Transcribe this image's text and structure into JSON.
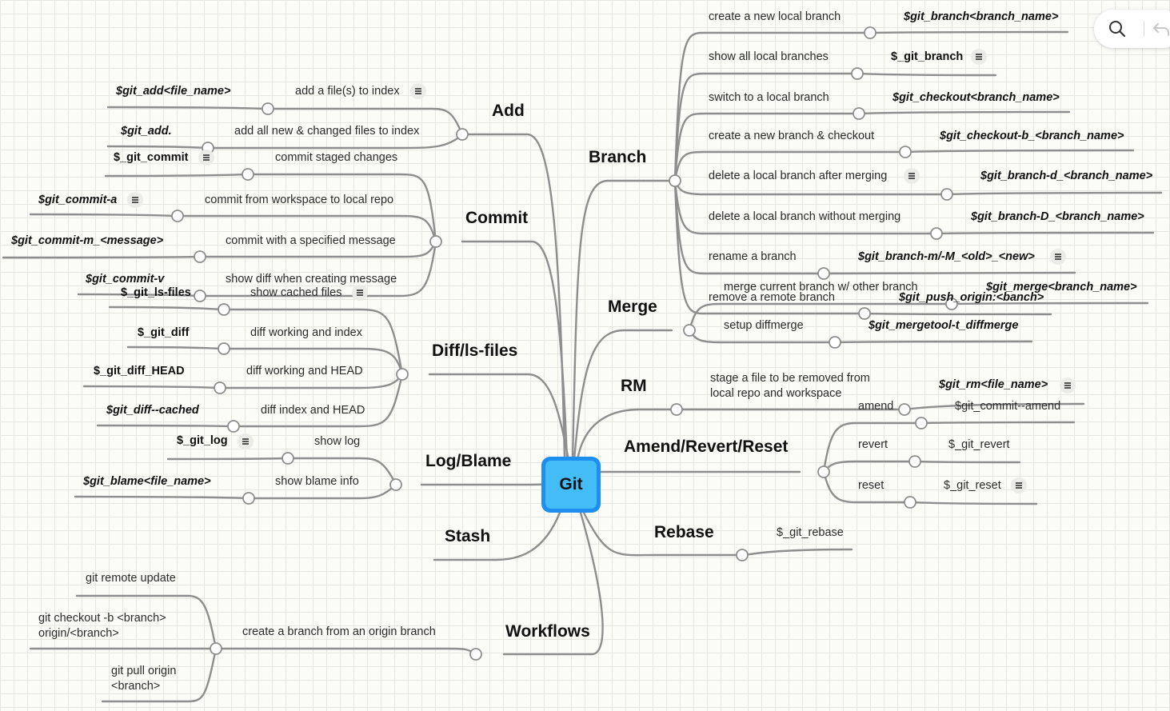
{
  "root": "Git",
  "topics": {
    "add": "Add",
    "commit": "Commit",
    "diff": "Diff/ls-files",
    "log": "Log/Blame",
    "stash": "Stash",
    "workflows": "Workflows",
    "branch": "Branch",
    "merge": "Merge",
    "rm": "RM",
    "amend": "Amend/Revert/Reset",
    "rebase": "Rebase"
  },
  "add": {
    "file_label": "add a file(s) to index",
    "file_cmd": "$git_add<file_name>",
    "all_label": "add all new & changed files to index",
    "all_cmd": "$git_add."
  },
  "commit": {
    "staged_label": "commit staged changes",
    "staged_cmd": "$_git_commit",
    "workspace_label": "commit from workspace to local repo",
    "workspace_cmd": "$git_commit-a",
    "message_label": "commit with a specified message",
    "message_cmd": "$git_commit-m_<message>",
    "diff_label": "show diff when creating message",
    "diff_cmd": "$git_commit-v"
  },
  "diff": {
    "cached_label": "show cached files",
    "cached_cmd": "$_git_ls-files",
    "wi_label": "diff working and index",
    "wi_cmd": "$_git_diff",
    "wh_label": "diff working and HEAD",
    "wh_cmd": "$_git_diff_HEAD",
    "ih_label": "diff index and HEAD",
    "ih_cmd": "$git_diff--cached"
  },
  "log": {
    "log_label": "show log",
    "log_cmd": "$_git_log",
    "blame_label": "show blame info",
    "blame_cmd": "$git_blame<file_name>"
  },
  "workflows": {
    "branch_label": "create a branch from an origin branch",
    "remote_update": "git remote update",
    "checkout": "git checkout -b <branch> origin/<branch>",
    "pull": "git pull origin <branch>"
  },
  "branch": {
    "create_label": "create a new local branch",
    "create_cmd": "$git_branch<branch_name>",
    "show_label": "show all local branches",
    "show_cmd": "$_git_branch",
    "switch_label": "switch to a local branch",
    "switch_cmd": "$git_checkout<branch_name>",
    "checkout_label": "create a new branch & checkout",
    "checkout_cmd": "$git_checkout-b_<branch_name>",
    "delete_label": "delete a local branch after merging",
    "delete_cmd": "$git_branch-d_<branch_name>",
    "force_label": "delete a local branch without merging",
    "force_cmd": "$git_branch-D_<branch_name>",
    "rename_label": "rename a branch",
    "rename_cmd": "$git_branch-m/-M_<old>_<new>",
    "remote_label": "remove a remote branch",
    "remote_cmd": "$git_push_origin:<banch>"
  },
  "merge": {
    "merge_label": "merge current branch w/ other branch",
    "merge_cmd": "$git_merge<branch_name>",
    "tool_label": "setup diffmerge",
    "tool_cmd": "$git_mergetool-t_diffmerge"
  },
  "rm": {
    "label": "stage a file to be removed from local repo and workspace",
    "cmd": "$git_rm<file_name>"
  },
  "amend": {
    "amend_label": "amend",
    "amend_cmd": "$git_commit--amend",
    "revert_label": "revert",
    "revert_cmd": "$_git_revert",
    "reset_label": "reset",
    "reset_cmd": "$_git_reset"
  },
  "rebase": {
    "cmd": "$_git_rebase"
  },
  "toolbar": {
    "search_icon": "search-icon",
    "undo_icon": "undo-icon"
  }
}
